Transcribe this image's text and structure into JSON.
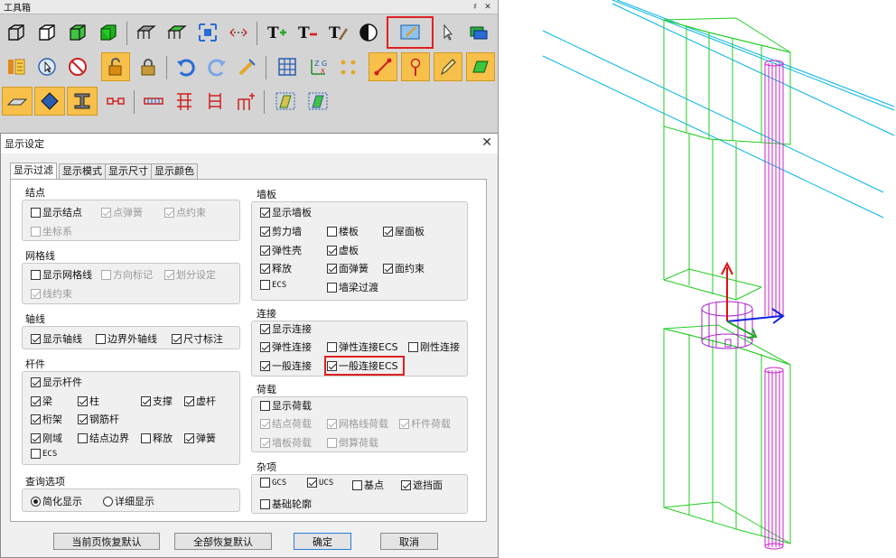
{
  "toolbox": {
    "title": "工具箱",
    "pin": "♯",
    "close": "✕",
    "rows": [
      [
        "cube-wire-icon",
        "cube-outline-icon",
        "cube-green-icon",
        "cube-solid-icon",
        "|",
        "mesh-select-icon",
        "mesh-filter-icon",
        "zoom-fit-icon",
        "measure-icon",
        "|",
        "text-add-icon",
        "text-remove-icon",
        "text-style-icon",
        "contrast-icon",
        "display-settings-icon",
        "pointer-icon",
        "layers-icon"
      ],
      [
        "property-icon",
        "select-circle-icon",
        "no-select-icon",
        "unlock-icon",
        "lock-icon",
        "|",
        "undo-icon",
        "redo-icon",
        "pencil-snap-icon",
        "|",
        "grid-icon",
        "axis-icon",
        "points-icon",
        "line-node-icon",
        "pin-icon",
        "draw-pencil-icon",
        "plate-icon"
      ],
      [
        "slab-icon",
        "diamond-icon",
        "beam-section-icon",
        "link-icon",
        "|",
        "brace-icon",
        "wall-icon",
        "column-grid-icon",
        "add-member-icon",
        "|",
        "copy-member-icon",
        "paste-member-icon"
      ]
    ]
  },
  "dialog": {
    "title": "显示设定",
    "close": "✕",
    "tabs": [
      "显示过滤",
      "显示模式",
      "显示尺寸",
      "显示颜色"
    ],
    "groups": {
      "node": {
        "label": "结点",
        "options": [
          {
            "label": "显示结点",
            "checked": false,
            "disabled": false
          },
          {
            "label": "点弹簧",
            "checked": true,
            "disabled": true
          },
          {
            "label": "点约束",
            "checked": true,
            "disabled": true
          },
          {
            "label": "坐标系",
            "checked": false,
            "disabled": true
          }
        ]
      },
      "grid": {
        "label": "网格线",
        "options": [
          {
            "label": "显示网格线",
            "checked": false,
            "disabled": false
          },
          {
            "label": "方向标记",
            "checked": false,
            "disabled": true
          },
          {
            "label": "划分设定",
            "checked": true,
            "disabled": true
          },
          {
            "label": "线约束",
            "checked": true,
            "disabled": true
          }
        ]
      },
      "axis": {
        "label": "轴线",
        "options": [
          {
            "label": "显示轴线",
            "checked": true,
            "disabled": false
          },
          {
            "label": "边界外轴线",
            "checked": false,
            "disabled": false
          },
          {
            "label": "尺寸标注",
            "checked": true,
            "disabled": false
          }
        ]
      },
      "member": {
        "label": "杆件",
        "options": [
          {
            "label": "显示杆件",
            "checked": true,
            "disabled": false
          },
          {
            "label": "梁",
            "checked": true,
            "disabled": false
          },
          {
            "label": "柱",
            "checked": true,
            "disabled": false
          },
          {
            "label": "支撑",
            "checked": true,
            "disabled": false
          },
          {
            "label": "虚杆",
            "checked": true,
            "disabled": false
          },
          {
            "label": "桁架",
            "checked": true,
            "disabled": false
          },
          {
            "label": "钢筋杆",
            "checked": true,
            "disabled": false
          },
          {
            "label": "刚域",
            "checked": true,
            "disabled": false
          },
          {
            "label": "结点边界",
            "checked": false,
            "disabled": false
          },
          {
            "label": "释放",
            "checked": false,
            "disabled": false
          },
          {
            "label": "弹簧",
            "checked": true,
            "disabled": false
          },
          {
            "label": "ECS",
            "checked": false,
            "disabled": false
          }
        ]
      },
      "query": {
        "label": "查询选项",
        "options": [
          {
            "label": "简化显示",
            "checked": true
          },
          {
            "label": "详细显示",
            "checked": false
          }
        ]
      },
      "wall": {
        "label": "墙板",
        "options": [
          {
            "label": "显示墙板",
            "checked": true,
            "disabled": false
          },
          {
            "label": "剪力墙",
            "checked": true,
            "disabled": false
          },
          {
            "label": "楼板",
            "checked": false,
            "disabled": false
          },
          {
            "label": "屋面板",
            "checked": true,
            "disabled": false
          },
          {
            "label": "弹性壳",
            "checked": true,
            "disabled": false
          },
          {
            "label": "虚板",
            "checked": true,
            "disabled": false
          },
          {
            "label": "释放",
            "checked": true,
            "disabled": false
          },
          {
            "label": "面弹簧",
            "checked": true,
            "disabled": false
          },
          {
            "label": "面约束",
            "checked": true,
            "disabled": false
          },
          {
            "label": "ECS",
            "checked": false,
            "disabled": false
          },
          {
            "label": "墙梁过渡",
            "checked": false,
            "disabled": false
          }
        ]
      },
      "link": {
        "label": "连接",
        "options": [
          {
            "label": "显示连接",
            "checked": true,
            "disabled": false
          },
          {
            "label": "弹性连接",
            "checked": true,
            "disabled": false
          },
          {
            "label": "弹性连接ECS",
            "checked": false,
            "disabled": false
          },
          {
            "label": "刚性连接",
            "checked": false,
            "disabled": false
          },
          {
            "label": "一般连接",
            "checked": true,
            "disabled": false
          },
          {
            "label": "一般连接ECS",
            "checked": true,
            "disabled": false
          }
        ]
      },
      "load": {
        "label": "荷载",
        "options": [
          {
            "label": "显示荷载",
            "checked": false,
            "disabled": false
          },
          {
            "label": "结点荷载",
            "checked": true,
            "disabled": true
          },
          {
            "label": "网格线荷载",
            "checked": true,
            "disabled": true
          },
          {
            "label": "杆件荷载",
            "checked": true,
            "disabled": true
          },
          {
            "label": "墙板荷载",
            "checked": true,
            "disabled": true
          },
          {
            "label": "倒算荷载",
            "checked": false,
            "disabled": true
          }
        ]
      },
      "misc": {
        "label": "杂项",
        "options": [
          {
            "label": "GCS",
            "checked": false,
            "disabled": false
          },
          {
            "label": "UCS",
            "checked": true,
            "disabled": false
          },
          {
            "label": "基点",
            "checked": false,
            "disabled": false
          },
          {
            "label": "遮挡面",
            "checked": true,
            "disabled": false
          },
          {
            "label": "基础轮廓",
            "checked": false,
            "disabled": false
          }
        ]
      }
    },
    "buttons": {
      "reset_page": "当前页恢复默认",
      "reset_all": "全部恢复默认",
      "ok": "确定",
      "cancel": "取消"
    }
  },
  "viewport": {
    "colors": {
      "gridlines": "#00b4e6",
      "walls": "#22cc22",
      "columns": "#cc22cc",
      "link_disk": "#aa22cc",
      "axis_z": "#dd1111",
      "axis_x": "#1122dd",
      "axis_y": "#22aa22"
    }
  }
}
